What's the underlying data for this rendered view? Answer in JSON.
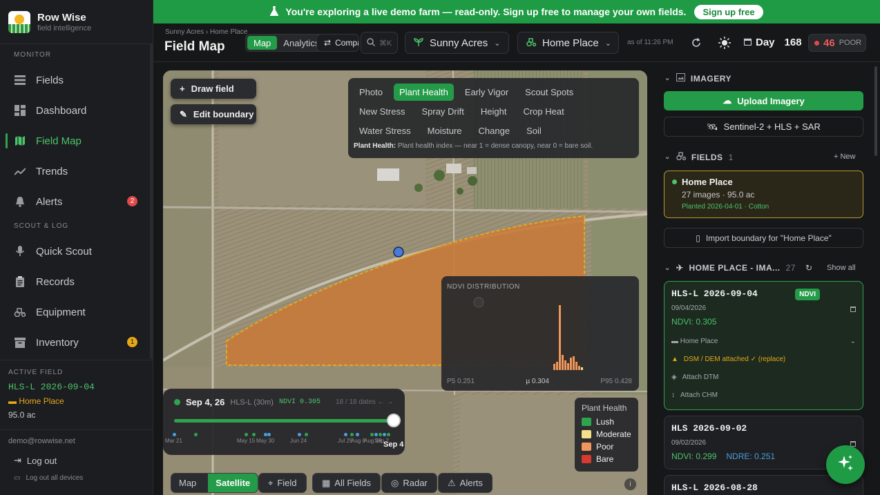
{
  "brand": {
    "name": "Row Wise",
    "subtitle": "field intelligence"
  },
  "sidebar": {
    "section_monitor": "MONITOR",
    "section_scout": "SCOUT & LOG",
    "items": [
      {
        "label": "Fields"
      },
      {
        "label": "Dashboard"
      },
      {
        "label": "Field Map",
        "active": true
      },
      {
        "label": "Trends"
      },
      {
        "label": "Alerts",
        "badge": "2"
      },
      {
        "label": "Quick Scout"
      },
      {
        "label": "Records"
      },
      {
        "label": "Equipment"
      },
      {
        "label": "Inventory",
        "badge": "1"
      }
    ],
    "active_field": {
      "label": "ACTIVE FIELD",
      "name": "HLS-L 2026-09-04",
      "farm": "Home Place",
      "acres": "95.0 ac"
    },
    "account": {
      "email": "demo@rowwise.net",
      "logout": "Log out",
      "logout_all": "Log out all devices"
    }
  },
  "banner": {
    "text": "You're exploring a live demo farm — read-only. Sign up free to manage your own fields.",
    "button": "Sign up free"
  },
  "topbar": {
    "breadcrumb": "Sunny Acres › Home Place",
    "title": "Field Map",
    "view_tabs": [
      "Map",
      "Analytics"
    ],
    "compare": "Compare",
    "search_hint": "⌘K",
    "farm": "Sunny Acres",
    "field": "Home Place",
    "as_of": "as of 11:26 PM",
    "day_label": "Day",
    "day_value": "168",
    "health_value": "46",
    "health_label": "POOR"
  },
  "map": {
    "draw_field": "Draw field",
    "edit_boundary": "Edit boundary",
    "layers": [
      [
        "Photo",
        "Plant Health",
        "Early Vigor",
        "Scout Spots"
      ],
      [
        "New Stress",
        "Spray Drift",
        "Height",
        "Crop Heat"
      ],
      [
        "Water Stress",
        "Moisture",
        "Change",
        "Soil"
      ]
    ],
    "active_layer": "Plant Health",
    "layer_desc_title": "Plant Health:",
    "layer_desc": "Plant health index — near 1 = dense canopy, near 0 = bare soil.",
    "distribution": {
      "title": "NDVI DISTRIBUTION",
      "p5": "P5 0.251",
      "mean": "µ 0.304",
      "p95": "P95 0.428"
    },
    "timeline": {
      "date": "Sep 4, 26",
      "sensor": "HLS-L (30m)",
      "ndvi": "NDVI 0.305",
      "count": "18 / 18 dates",
      "arrows": "← →",
      "labels": [
        "Mar 21",
        "May 15",
        "May 30",
        "Jun 24",
        "Jul 29",
        "Aug 8",
        "Aug 28",
        "Sep 2"
      ],
      "selected_label": "Sep 4"
    },
    "legend": {
      "title": "Plant Health",
      "items": [
        {
          "label": "Lush",
          "color": "#2fa44f"
        },
        {
          "label": "Moderate",
          "color": "#f5df8a"
        },
        {
          "label": "Poor",
          "color": "#f0965a"
        },
        {
          "label": "Bare",
          "color": "#d93a2f"
        }
      ]
    },
    "bottom": {
      "map": "Map",
      "satellite": "Satellite",
      "field": "Field",
      "all_fields": "All Fields",
      "radar": "Radar",
      "alerts": "Alerts"
    }
  },
  "right": {
    "imagery_title": "IMAGERY",
    "upload": "Upload Imagery",
    "sentinel": "Sentinel-2 + HLS + SAR",
    "fields_title": "FIELDS",
    "fields_count": "1",
    "new": "+ New",
    "field_card": {
      "name": "Home Place",
      "meta": "27 images · 95.0 ac",
      "planted": "Planted 2026-04-01 · Cotton"
    },
    "import": "Import boundary for \"Home Place\"",
    "images_title": "HOME PLACE - IMA...",
    "images_count": "27",
    "show_all": "Show all",
    "cards": [
      {
        "title": "HLS-L 2026-09-04",
        "tag": "NDVI",
        "date": "09/04/2026",
        "ndvi": "NDVI: 0.305",
        "farm": "Home Place",
        "dsm": "DSM / DEM attached ✓ (replace)",
        "dtm": "Attach DTM",
        "chm": "Attach CHM"
      },
      {
        "title": "HLS 2026-09-02",
        "date": "09/02/2026",
        "ndvi": "NDVI: 0.299",
        "ndre": "NDRE: 0.251"
      },
      {
        "title": "HLS-L 2026-08-28"
      }
    ]
  },
  "colors": {
    "accent": "#249b48",
    "poor": "#f05a5a",
    "warning": "#e6a817"
  }
}
